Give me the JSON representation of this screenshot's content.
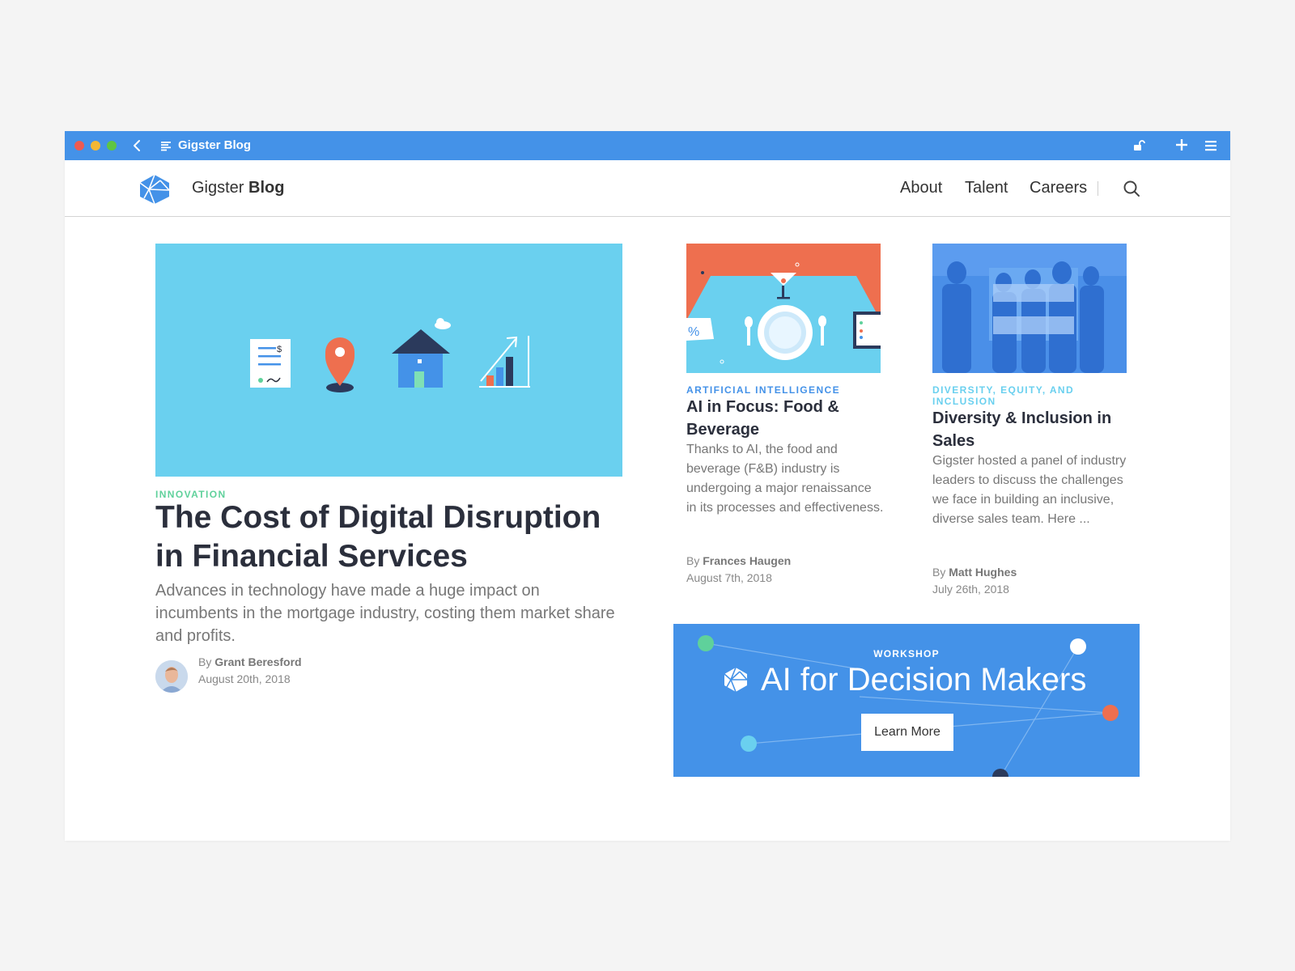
{
  "browser": {
    "title": "Gigster Blog"
  },
  "header": {
    "brand_name": "Gigster",
    "brand_suffix": "Blog",
    "nav": [
      "About",
      "Talent",
      "Careers"
    ]
  },
  "hero": {
    "category": "INNOVATION",
    "title": "The Cost of Digital Disruption in Financial Services",
    "excerpt": "Advances in technology have made a huge impact on incumbents in the mortgage industry, costing them market share and profits.",
    "by": "By",
    "author": "Grant Beresford",
    "date": "August 20th, 2018"
  },
  "cards": [
    {
      "category": "ARTIFICIAL INTELLIGENCE",
      "title": "AI in Focus: Food & Beverage",
      "excerpt": "Thanks to AI, the food and beverage (F&B) industry is undergoing a major renaissance in its processes and effectiveness.",
      "by": "By",
      "author": "Frances Haugen",
      "date": "August 7th, 2018"
    },
    {
      "category": "DIVERSITY, EQUITY, AND INCLUSION",
      "title": "Diversity & Inclusion in Sales",
      "excerpt": "Gigster hosted a panel of industry leaders to discuss the challenges we face in building an inclusive, diverse sales team. Here ...",
      "by": "By",
      "author": "Matt Hughes",
      "date": "July 26th, 2018"
    }
  ],
  "banner": {
    "label": "WORKSHOP",
    "title": "AI for Decision Makers",
    "button": "Learn More"
  },
  "colors": {
    "accent": "#4492e8",
    "hero_bg": "#6ad0ef",
    "innovation": "#5fd19b",
    "coral": "#ee6f4f"
  }
}
